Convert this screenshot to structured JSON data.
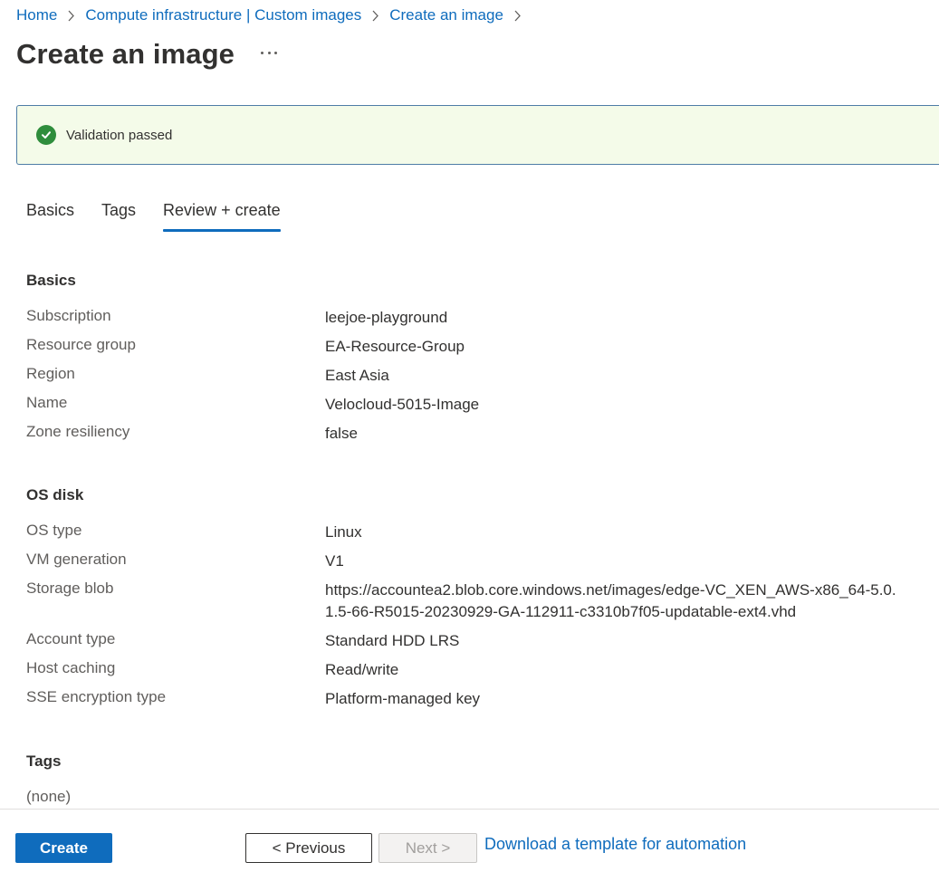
{
  "breadcrumb": {
    "items": [
      "Home",
      "Compute infrastructure | Custom images",
      "Create an image"
    ]
  },
  "page": {
    "title": "Create an image"
  },
  "banner": {
    "text": "Validation passed"
  },
  "tabs": [
    {
      "label": "Basics",
      "active": false
    },
    {
      "label": "Tags",
      "active": false
    },
    {
      "label": "Review + create",
      "active": true
    }
  ],
  "basics": {
    "title": "Basics",
    "rows": [
      {
        "label": "Subscription",
        "value": "leejoe-playground"
      },
      {
        "label": "Resource group",
        "value": "EA-Resource-Group"
      },
      {
        "label": "Region",
        "value": "East Asia"
      },
      {
        "label": "Name",
        "value": "Velocloud-5015-Image"
      },
      {
        "label": "Zone resiliency",
        "value": "false"
      }
    ]
  },
  "os_disk": {
    "title": "OS disk",
    "rows": [
      {
        "label": "OS type",
        "value": "Linux"
      },
      {
        "label": "VM generation",
        "value": "V1"
      },
      {
        "label": "Storage blob",
        "value": "https://accountea2.blob.core.windows.net/images/edge-VC_XEN_AWS-x86_64-5.0.1.5-66-R5015-20230929-GA-112911-c3310b7f05-updatable-ext4.vhd"
      },
      {
        "label": "Account type",
        "value": "Standard HDD LRS"
      },
      {
        "label": "Host caching",
        "value": "Read/write"
      },
      {
        "label": "SSE encryption type",
        "value": "Platform-managed key"
      }
    ]
  },
  "tags": {
    "title": "Tags",
    "value": "(none)"
  },
  "footer": {
    "create_label": "Create",
    "previous_label": "< Previous",
    "next_label": "Next >",
    "download_link": "Download a template for automation"
  },
  "colors": {
    "accent": "#0f6cbd",
    "success": "#2f8d3c",
    "banner_bg": "#f4fbe9"
  }
}
